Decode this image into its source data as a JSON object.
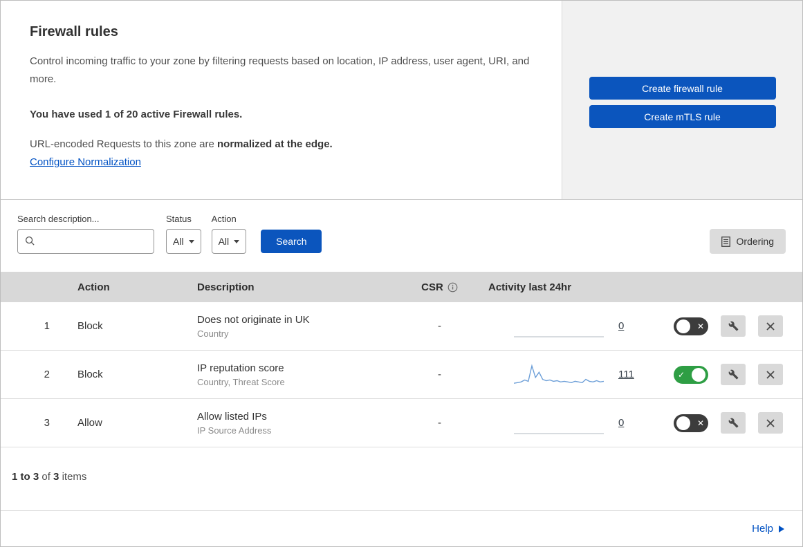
{
  "colors": {
    "primary_blue": "#0b55bd",
    "link_blue": "#0051c3",
    "toggle_green": "#2e9e44",
    "sparkline_blue": "#6d9fd8",
    "sparkline_empty": "#ccd1d6"
  },
  "header": {
    "title": "Firewall rules",
    "description": "Control incoming traffic to your zone by filtering requests based on location, IP address, user agent, URI, and more.",
    "usage_notice": "You have used 1 of 20 active Firewall rules.",
    "normalization_text": "URL-encoded Requests to this zone are",
    "normalization_bold": "normalized at the edge.",
    "normalization_link": "Configure Normalization",
    "create_firewall_button": "Create firewall rule",
    "create_mtls_button": "Create mTLS rule"
  },
  "filters": {
    "search_label": "Search description...",
    "status_label": "Status",
    "status_value": "All",
    "action_label": "Action",
    "action_value": "All",
    "search_button": "Search",
    "ordering_button": "Ordering"
  },
  "table": {
    "columns": {
      "action": "Action",
      "description": "Description",
      "csr": "CSR",
      "activity": "Activity last 24hr"
    },
    "rows": [
      {
        "priority": "1",
        "action": "Block",
        "description": "Does not originate in UK",
        "criteria": "Country",
        "csr": "-",
        "activity_count": "0",
        "enabled": false,
        "sparkline": [
          0,
          0,
          0,
          0,
          0,
          0,
          0,
          0,
          0,
          0,
          0,
          0,
          0
        ]
      },
      {
        "priority": "2",
        "action": "Block",
        "description": "IP reputation score",
        "criteria": "Country, Threat Score",
        "csr": "-",
        "activity_count": "111",
        "enabled": true,
        "sparkline": [
          3,
          4,
          5,
          8,
          6,
          30,
          12,
          20,
          9,
          7,
          8,
          6,
          7,
          5,
          6,
          5,
          4,
          6,
          5,
          4,
          9,
          6,
          5,
          7,
          5,
          6
        ]
      },
      {
        "priority": "3",
        "action": "Allow",
        "description": "Allow listed IPs",
        "criteria": "IP Source Address",
        "csr": "-",
        "activity_count": "0",
        "enabled": false,
        "sparkline": [
          0,
          0,
          0,
          0,
          0,
          0,
          0,
          0,
          0,
          0,
          0,
          0,
          0
        ]
      }
    ],
    "summary": {
      "range": "1 to 3",
      "of": "of",
      "total": "3",
      "items": "items"
    }
  },
  "footer": {
    "help_label": "Help"
  }
}
